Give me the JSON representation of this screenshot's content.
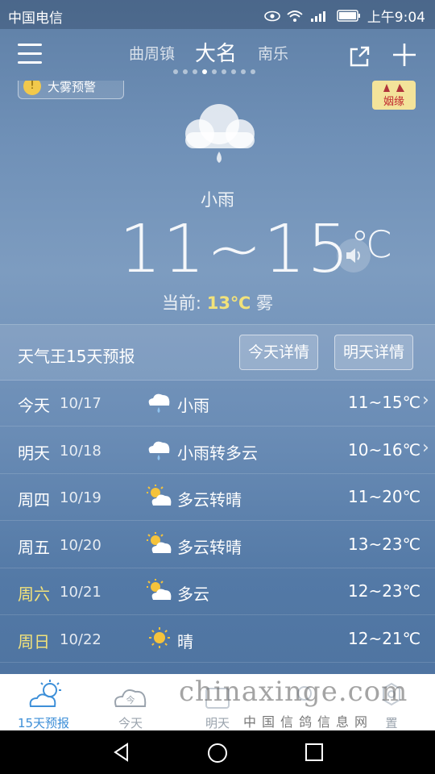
{
  "status_bar": {
    "carrier": "中国电信",
    "time": "上午9:04"
  },
  "header": {
    "cities": [
      "曲周镇",
      "大名",
      "南乐"
    ],
    "active_city_index": 1,
    "page_dots": 9,
    "active_dot": 3
  },
  "warning": {
    "text": "大雾预警",
    "icon": "warning-icon"
  },
  "ad": {
    "text": "姻缘"
  },
  "current_weather": {
    "condition": "小雨",
    "temp_range": "11~15",
    "unit": "℃",
    "current_label": "当前:",
    "current_temp": "13℃",
    "current_condition": "雾"
  },
  "forecast": {
    "title": "天气王15天预报",
    "today_detail_label": "今天详情",
    "tomorrow_detail_label": "明天详情",
    "rows": [
      {
        "day": "今天",
        "date": "10/17",
        "icon": "rain-cloud-icon",
        "desc": "小雨",
        "range": "11~15℃",
        "chevron": true,
        "weekend": false
      },
      {
        "day": "明天",
        "date": "10/18",
        "icon": "rain-cloud-icon",
        "desc": "小雨转多云",
        "range": "10~16℃",
        "chevron": true,
        "weekend": false
      },
      {
        "day": "周四",
        "date": "10/19",
        "icon": "partly-cloudy-icon",
        "desc": "多云转晴",
        "range": "11~20℃",
        "chevron": false,
        "weekend": false
      },
      {
        "day": "周五",
        "date": "10/20",
        "icon": "partly-cloudy-icon",
        "desc": "多云转晴",
        "range": "13~23℃",
        "chevron": false,
        "weekend": false
      },
      {
        "day": "周六",
        "date": "10/21",
        "icon": "partly-cloudy-icon",
        "desc": "多云",
        "range": "12~23℃",
        "chevron": false,
        "weekend": true
      },
      {
        "day": "周日",
        "date": "10/22",
        "icon": "sun-icon",
        "desc": "晴",
        "range": "12~21℃",
        "chevron": false,
        "weekend": true
      }
    ]
  },
  "bottom_nav": {
    "items": [
      {
        "label": "15天预报",
        "icon": "sun-cloud-icon",
        "active": true
      },
      {
        "label": "今天",
        "icon": "cloud-today-icon",
        "active": false
      },
      {
        "label": "明天",
        "icon": "calendar-icon",
        "active": false
      },
      {
        "label": "",
        "icon": "location-icon",
        "active": false
      },
      {
        "label": "置",
        "icon": "settings-icon",
        "active": false
      }
    ]
  },
  "watermark": {
    "text": "chinaxinge.com",
    "sub": "中国信鸽信息网"
  },
  "colors": {
    "accent": "#3d8fd8",
    "weekend": "#f2e27a",
    "current_temp": "#f2e27a"
  }
}
